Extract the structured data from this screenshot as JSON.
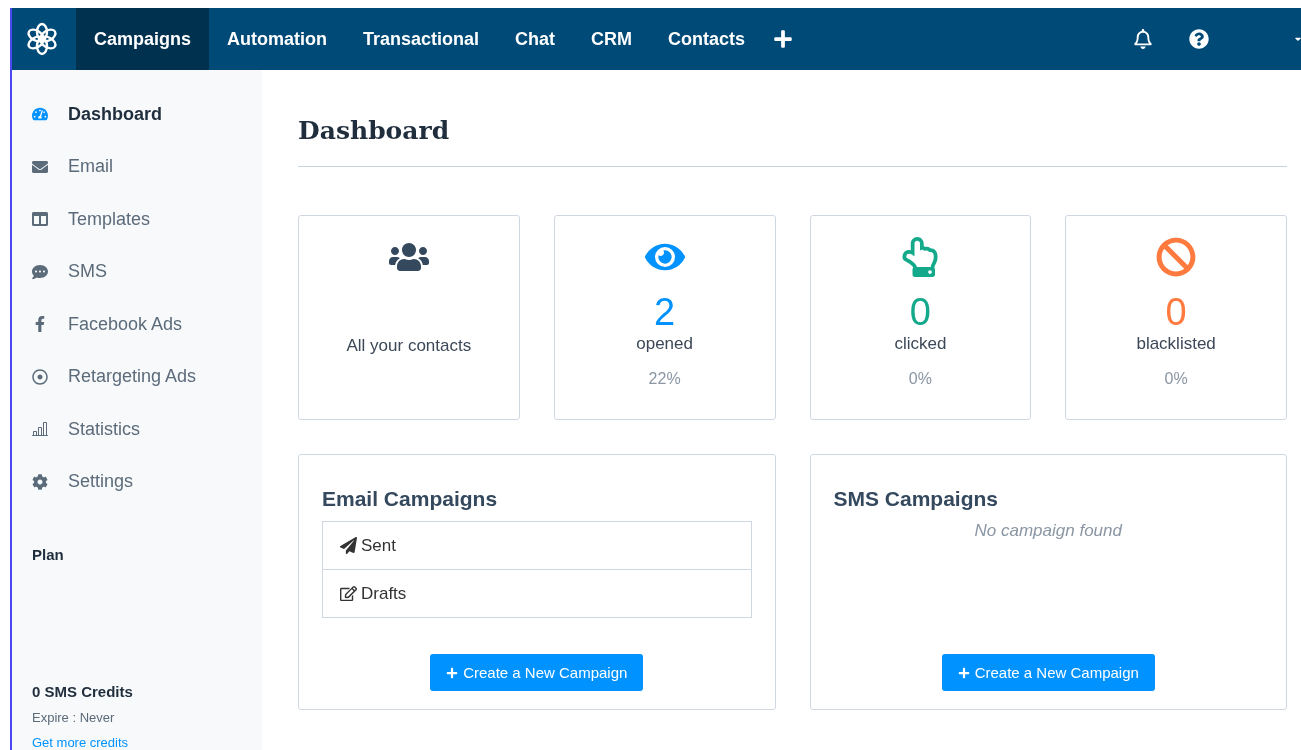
{
  "nav": {
    "items": [
      {
        "label": "Campaigns",
        "selected": true
      },
      {
        "label": "Automation",
        "selected": false
      },
      {
        "label": "Transactional",
        "selected": false
      },
      {
        "label": "Chat",
        "selected": false
      },
      {
        "label": "CRM",
        "selected": false
      },
      {
        "label": "Contacts",
        "selected": false
      }
    ]
  },
  "sidebar": {
    "items": [
      {
        "label": "Dashboard",
        "kind": "dashboard",
        "selected": true
      },
      {
        "label": "Email",
        "kind": "email",
        "selected": false
      },
      {
        "label": "Templates",
        "kind": "templates",
        "selected": false
      },
      {
        "label": "SMS",
        "kind": "sms",
        "selected": false
      },
      {
        "label": "Facebook Ads",
        "kind": "facebook",
        "selected": false
      },
      {
        "label": "Retargeting Ads",
        "kind": "retargeting",
        "selected": false
      },
      {
        "label": "Statistics",
        "kind": "statistics",
        "selected": false
      },
      {
        "label": "Settings",
        "kind": "settings",
        "selected": false
      }
    ],
    "plan": "Plan",
    "credits": {
      "title": "0 SMS Credits",
      "expire": "Expire : Never",
      "link": "Get more credits"
    }
  },
  "page_title": "Dashboard",
  "stats": [
    {
      "kind": "contacts",
      "label": "All your contacts",
      "color": "#34495e"
    },
    {
      "kind": "opened",
      "value": "2",
      "label": "opened",
      "percent": "22%",
      "color": "#0092ff"
    },
    {
      "kind": "clicked",
      "value": "0",
      "label": "clicked",
      "percent": "0%",
      "color": "#13a98a"
    },
    {
      "kind": "blacklisted",
      "value": "0",
      "label": "blacklisted",
      "percent": "0%",
      "color": "#ff7a3f"
    }
  ],
  "email_campaigns": {
    "title": "Email Campaigns",
    "rows": [
      {
        "kind": "sent",
        "label": "Sent"
      },
      {
        "kind": "drafts",
        "label": "Drafts"
      }
    ],
    "button": "Create a New Campaign"
  },
  "sms_campaigns": {
    "title": "SMS Campaigns",
    "empty": "No campaign found",
    "button": "Create a New Campaign"
  }
}
